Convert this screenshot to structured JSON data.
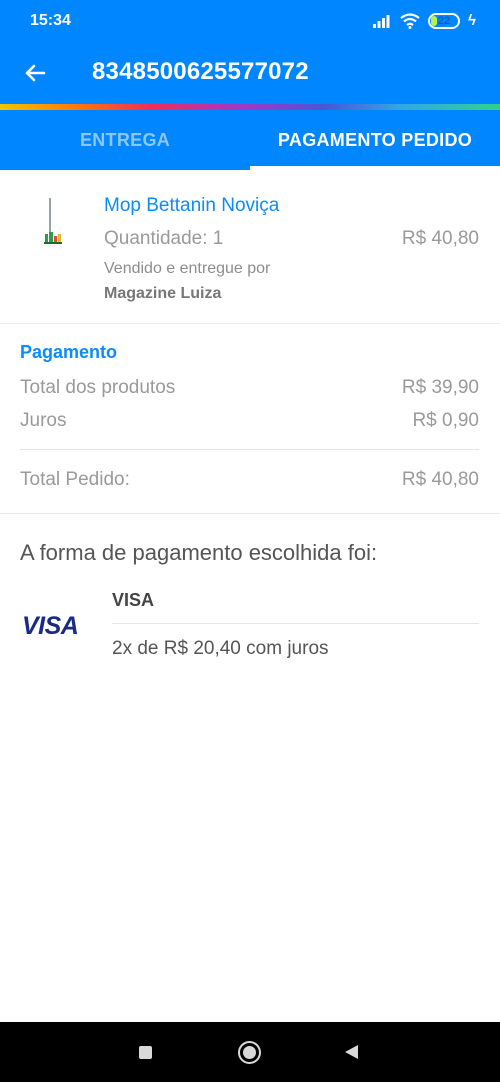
{
  "status_bar": {
    "time": "15:34",
    "battery_level": "22",
    "icons": [
      "signal-icon",
      "wifi-icon",
      "battery-icon",
      "charging-bolt-icon"
    ]
  },
  "app_bar": {
    "back_icon": "arrow-left-icon",
    "title": "8348500625577072"
  },
  "tabs": [
    {
      "label": "ENTREGA",
      "active": false
    },
    {
      "label": "PAGAMENTO PEDIDO",
      "active": true
    }
  ],
  "product": {
    "name": "Mop Bettanin Noviça",
    "quantity": "Quantidade: 1",
    "price": "R$ 40,80",
    "seller_label": "Vendido e entregue por",
    "seller_name": "Magazine Luiza"
  },
  "payment": {
    "title": "Pagamento",
    "rows": [
      {
        "label": "Total dos produtos",
        "value": "R$ 39,90"
      },
      {
        "label": "Juros",
        "value": "R$ 0,90"
      }
    ],
    "total_label": "Total Pedido:",
    "total_value": "R$ 40,80"
  },
  "payment_method": {
    "heading": "A forma de pagamento escolhida foi:",
    "logo_text": "VISA",
    "brand": "VISA",
    "installments": "2x de R$ 20,40 com juros"
  },
  "colors": {
    "primary": "#0086ff",
    "accent_text": "#0a8cff",
    "muted_text": "#9a9a9a"
  },
  "nav_bar": {
    "icons": [
      "recent-apps-icon",
      "home-icon",
      "back-icon"
    ]
  }
}
